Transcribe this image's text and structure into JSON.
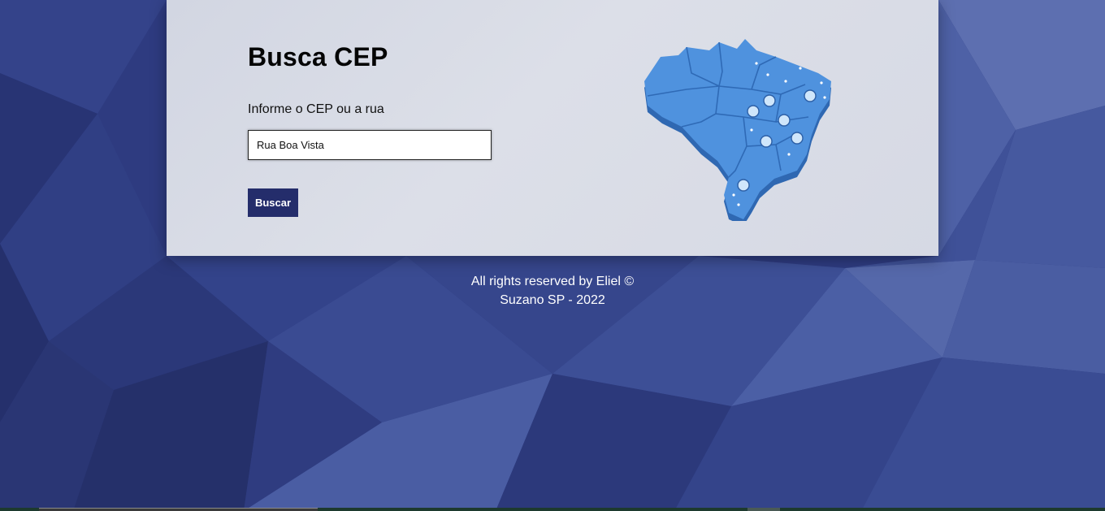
{
  "page": {
    "title": "Busca CEP",
    "input_label": "Informe o CEP ou a rua",
    "search_value": "Rua Boa Vista",
    "button_label": "Buscar"
  },
  "footer": {
    "line1": "All rights reserved by Eliel ©",
    "line2": "Suzano SP - 2022"
  },
  "colors": {
    "background": "#2d3a7e",
    "card": "#d6d9e4",
    "button": "#242d6b",
    "map": "#4a8fdb"
  },
  "icons": {
    "map": "brazil-map-icon",
    "pin": "map-pin-icon"
  }
}
